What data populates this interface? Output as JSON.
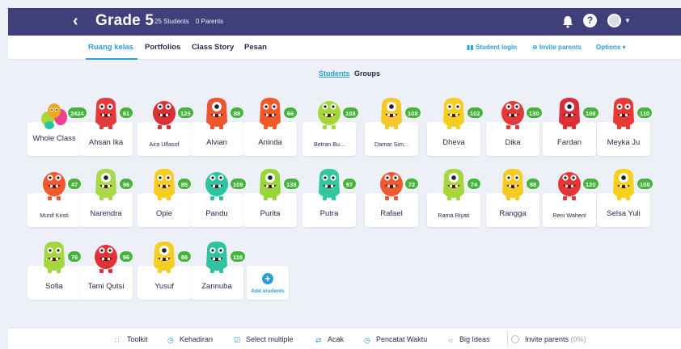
{
  "header": {
    "title": "Grade 5",
    "students_count": "25 Students",
    "parents_count": "0 Parents"
  },
  "tabs": [
    "Ruang kelas",
    "Portfolios",
    "Class Story",
    "Pesan"
  ],
  "right_links": {
    "student_login": "Student login",
    "invite_parents": "Invite parents",
    "options": "Options"
  },
  "view_toggle": {
    "students": "Students",
    "groups": "Groups"
  },
  "colors": {
    "header_bg": "#3f3f7c",
    "accent": "#2a9fd8",
    "points_badge": "#43b53a"
  },
  "whole_class": {
    "name": "Whole Class",
    "points": "2424"
  },
  "students": [
    {
      "name": "Ahsan Ika",
      "points": "61",
      "color": "#e23b3b"
    },
    {
      "name": "Aira Ulfasof",
      "points": "125",
      "color": "#d83236"
    },
    {
      "name": "Alvian",
      "points": "88",
      "color": "#ec5630"
    },
    {
      "name": "Aninda",
      "points": "66",
      "color": "#f05a28"
    },
    {
      "name": "Betran Bu...",
      "points": "108",
      "color": "#a5d63c"
    },
    {
      "name": "Damar Sim...",
      "points": "108",
      "color": "#f5c82b"
    },
    {
      "name": "Dheva",
      "points": "102",
      "color": "#f5cf1f"
    },
    {
      "name": "Dika",
      "points": "130",
      "color": "#e23a3a"
    },
    {
      "name": "Fardan",
      "points": "108",
      "color": "#dc2f3a"
    },
    {
      "name": "Meyka Ju",
      "points": "110",
      "color": "#e83a34"
    },
    {
      "name": "Munif Kristi",
      "points": "47",
      "color": "#ef5a2e"
    },
    {
      "name": "Narendra",
      "points": "96",
      "color": "#a8d94a"
    },
    {
      "name": "Opie",
      "points": "85",
      "color": "#f7cd22"
    },
    {
      "name": "Pandu",
      "points": "109",
      "color": "#2bc3a0"
    },
    {
      "name": "Purita",
      "points": "138",
      "color": "#96d639"
    },
    {
      "name": "Putra",
      "points": "97",
      "color": "#33c79e"
    },
    {
      "name": "Rafael",
      "points": "72",
      "color": "#ef5930"
    },
    {
      "name": "Rama Riyati",
      "points": "74",
      "color": "#a8d63c"
    },
    {
      "name": "Rangga",
      "points": "98",
      "color": "#f5cb22"
    },
    {
      "name": "Reni Waheni",
      "points": "120",
      "color": "#e43636"
    },
    {
      "name": "Selsa Yuli",
      "points": "108",
      "color": "#f5d11d"
    },
    {
      "name": "Sofia",
      "points": "76",
      "color": "#a4d63f"
    },
    {
      "name": "Tami Qutsi",
      "points": "96",
      "color": "#de3238"
    },
    {
      "name": "Yusuf",
      "points": "86",
      "color": "#f6cd23"
    },
    {
      "name": "Zannuba",
      "points": "116",
      "color": "#2fc4a0"
    }
  ],
  "add_students_label": "Add students",
  "bottom_bar": {
    "toolkit": "Toolkit",
    "attendance": "Kehadiran",
    "select_multiple": "Select multiple",
    "random": "Acak",
    "timer": "Pencatat Waktu",
    "big_ideas": "Big Ideas",
    "invite_parents": "Invite parents",
    "invite_percent": "(0%)"
  }
}
